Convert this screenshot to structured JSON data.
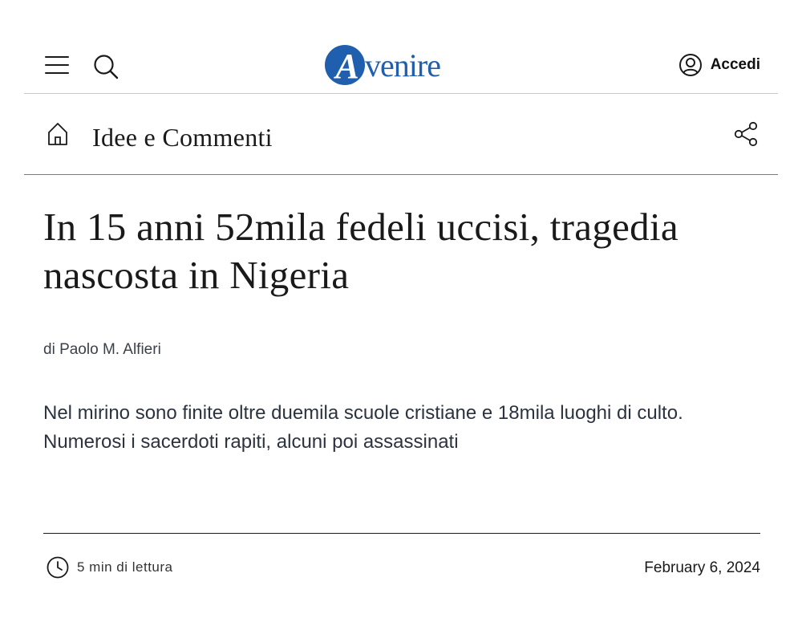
{
  "header": {
    "logo_initial": "A",
    "logo_rest": "venire",
    "login_label": "Accedi"
  },
  "section": {
    "title": "Idee e Commenti"
  },
  "article": {
    "headline": "In 15 anni 52mila fedeli uccisi, tragedia nascosta in Nigeria",
    "byline": "di Paolo M. Alfieri",
    "summary": "Nel mirino sono finite oltre duemila scuole cristiane e 18mila luoghi di culto. Numerosi i sacerdoti rapiti, alcuni poi assassinati",
    "read_time": "5 min di lettura",
    "date": "February 6, 2024"
  },
  "colors": {
    "brand": "#1f5fae",
    "text": "#1a1a1a",
    "summary_text": "#2c3340"
  },
  "icons": [
    "menu-icon",
    "search-icon",
    "user-icon",
    "home-icon",
    "share-icon",
    "clock-icon"
  ]
}
